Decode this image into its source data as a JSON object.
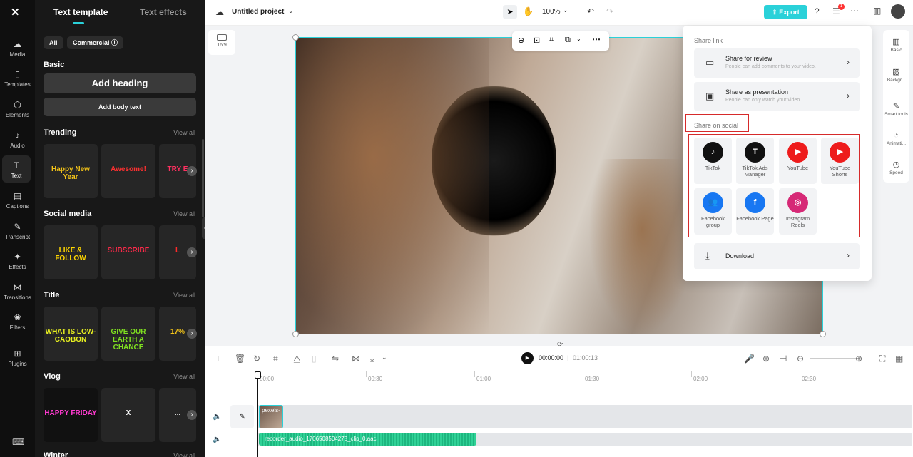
{
  "nav": {
    "items": [
      {
        "label": "Media",
        "icon": "media-icon",
        "glyph": "☁"
      },
      {
        "label": "Templates",
        "icon": "templates-icon",
        "glyph": "▯"
      },
      {
        "label": "Elements",
        "icon": "elements-icon",
        "glyph": "⬡"
      },
      {
        "label": "Audio",
        "icon": "audio-icon",
        "glyph": "♪"
      },
      {
        "label": "Text",
        "icon": "text-icon",
        "glyph": "T"
      },
      {
        "label": "Captions",
        "icon": "captions-icon",
        "glyph": "▤"
      },
      {
        "label": "Transcript",
        "icon": "transcript-icon",
        "glyph": "✎"
      },
      {
        "label": "Effects",
        "icon": "effects-icon",
        "glyph": "✦"
      },
      {
        "label": "Transitions",
        "icon": "transitions-icon",
        "glyph": "⋈"
      },
      {
        "label": "Filters",
        "icon": "filters-icon",
        "glyph": "❀"
      },
      {
        "label": "Plugins",
        "icon": "plugins-icon",
        "glyph": "⊞"
      }
    ]
  },
  "panel": {
    "tab_template": "Text template",
    "tab_effects": "Text effects",
    "chip_all": "All",
    "chip_commercial": "Commercial ⓘ",
    "basic": "Basic",
    "add_heading": "Add heading",
    "add_body": "Add body text",
    "sections": [
      {
        "title": "Trending",
        "view_all": "View all",
        "thumbs": [
          "Happy New Year",
          "Awesome!",
          "TRY E"
        ]
      },
      {
        "title": "Social media",
        "view_all": "View all",
        "thumbs": [
          "LIKE & FOLLOW",
          "SUBSCRIBE",
          "L"
        ]
      },
      {
        "title": "Title",
        "view_all": "View all",
        "thumbs": [
          "WHAT IS LOW-CAOBON",
          "GIVE OUR EARTH A CHANCE",
          "17%"
        ]
      },
      {
        "title": "Vlog",
        "view_all": "View all",
        "thumbs": [
          "HAPPY FRIDAY",
          "X",
          "..."
        ]
      },
      {
        "title": "Winter",
        "view_all": "View all",
        "thumbs": []
      }
    ]
  },
  "topbar": {
    "project": "Untitled project",
    "zoom": "100%",
    "export": "Export",
    "badge": "1"
  },
  "canvas": {
    "ratio": "16:9"
  },
  "right_tools": [
    "Basic",
    "Backgr...",
    "Smart tools",
    "Animati...",
    "Speed"
  ],
  "share": {
    "link_heading": "Share link",
    "review_title": "Share for review",
    "review_sub": "People can add comments to your video.",
    "present_title": "Share as presentation",
    "present_sub": "People can only watch your video.",
    "social_heading": "Share on social",
    "socials": [
      {
        "label": "TikTok",
        "color": "#111111",
        "glyph": "♪"
      },
      {
        "label": "TikTok Ads Manager",
        "color": "#111111",
        "glyph": "T"
      },
      {
        "label": "YouTube",
        "color": "#ee1c1c",
        "glyph": "▶"
      },
      {
        "label": "YouTube Shorts",
        "color": "#ee1c1c",
        "glyph": "▶"
      },
      {
        "label": "Facebook group",
        "color": "#1877f2",
        "glyph": "👥"
      },
      {
        "label": "Facebook Page",
        "color": "#1877f2",
        "glyph": "f"
      },
      {
        "label": "Instagram Reels",
        "color": "#d62976",
        "glyph": "◎"
      }
    ],
    "download": "Download"
  },
  "timeline": {
    "current": "00:00:00",
    "total": "01:00:13",
    "ticks": [
      "00:00",
      "00:30",
      "01:00",
      "01:30",
      "02:00",
      "02:30"
    ],
    "video_clip": "pexels-",
    "audio_clip": "recorder_audio_1706508504278_clip_0.aac"
  }
}
